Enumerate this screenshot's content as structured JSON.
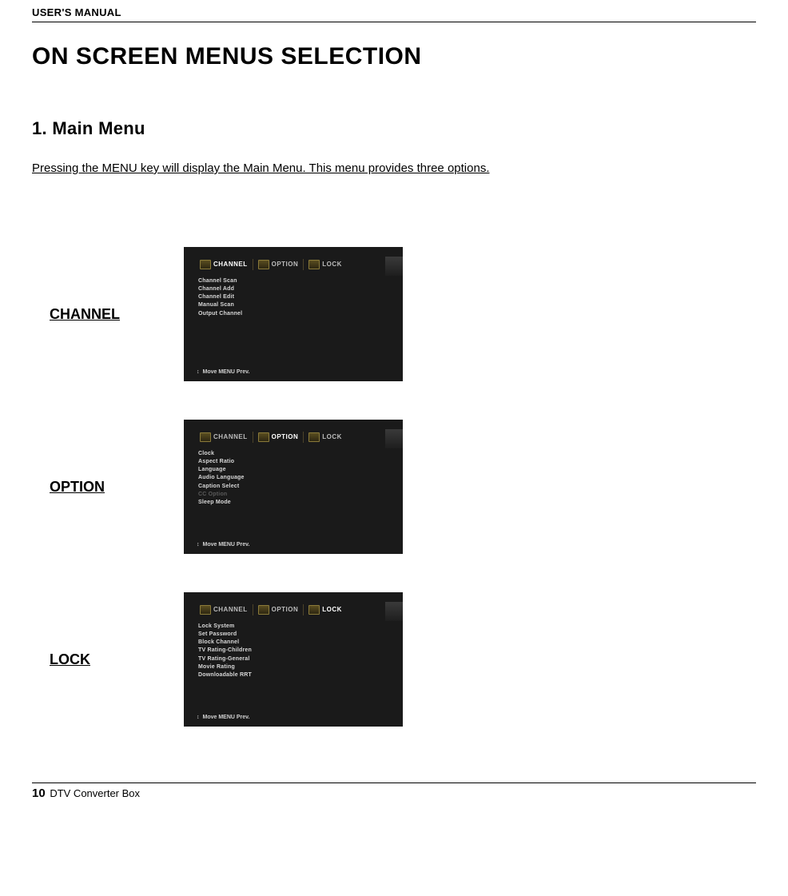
{
  "header": "USER'S MANUAL",
  "title": "ON SCREEN MENUS SELECTION",
  "subtitle": "1. Main Menu",
  "intro": "Pressing the MENU key will display the Main Menu. This menu provides three options.",
  "tabs": {
    "t1": "CHANNEL",
    "t2": "OPTION",
    "t3": "LOCK"
  },
  "rows": {
    "channel": {
      "label": "CHANNEL",
      "items": [
        "Channel Scan",
        "Channel Add",
        "Channel Edit",
        "Manual Scan",
        "Output Channel"
      ]
    },
    "option": {
      "label": "OPTION",
      "items": [
        "Clock",
        "Aspect Ratio",
        "Language",
        "Audio Language",
        "Caption Select"
      ],
      "dim": "CC Option",
      "extra": "Sleep Mode"
    },
    "lock": {
      "label": "LOCK",
      "items": [
        "Lock System",
        "Set Password",
        "Block Channel",
        "TV Rating-Children",
        "TV Rating-General",
        "Movie Rating",
        "Downloadable RRT"
      ]
    }
  },
  "hint": {
    "arrow": "↕",
    "text": "Move  MENU Prev."
  },
  "footer": {
    "page": "10",
    "product": "DTV Converter Box"
  }
}
